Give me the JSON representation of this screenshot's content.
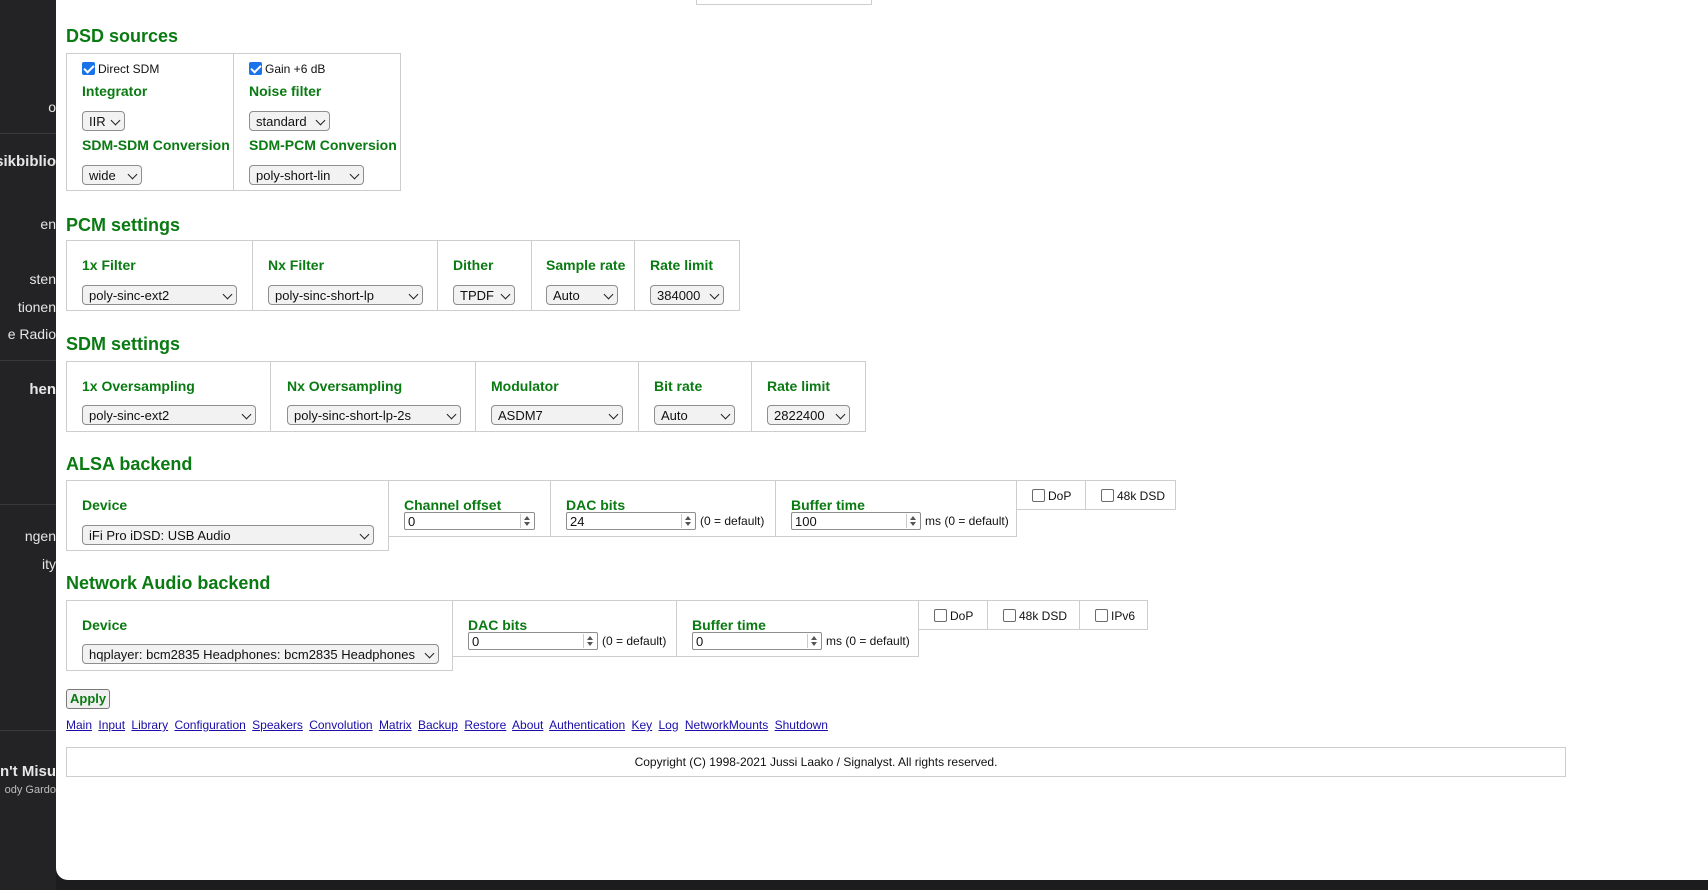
{
  "sidebar": {
    "items": [
      "o",
      "sikbiblio",
      "en",
      "sten",
      "tionen",
      "e Radio",
      "hen",
      "ngen",
      "ity"
    ],
    "now_playing": {
      "title": "n't Misu",
      "artist": "ody Gardo"
    }
  },
  "dsd": {
    "title": "DSD sources",
    "left": {
      "check_label": "Direct SDM",
      "check_on": true,
      "label1": "Integrator",
      "select1": "IIR",
      "label2": "SDM-SDM Conversion",
      "select2": "wide"
    },
    "right": {
      "check_label": "Gain +6 dB",
      "check_on": true,
      "label1": "Noise filter",
      "select1": "standard",
      "label2": "SDM-PCM Conversion",
      "select2": "poly-short-lin"
    }
  },
  "pcm": {
    "title": "PCM settings",
    "fields": [
      {
        "label": "1x Filter",
        "value": "poly-sinc-ext2"
      },
      {
        "label": "Nx Filter",
        "value": "poly-sinc-short-lp"
      },
      {
        "label": "Dither",
        "value": "TPDF"
      },
      {
        "label": "Sample rate",
        "value": "Auto"
      },
      {
        "label": "Rate limit",
        "value": "384000"
      }
    ]
  },
  "sdm": {
    "title": "SDM settings",
    "fields": [
      {
        "label": "1x Oversampling",
        "value": "poly-sinc-ext2"
      },
      {
        "label": "Nx Oversampling",
        "value": "poly-sinc-short-lp-2s"
      },
      {
        "label": "Modulator",
        "value": "ASDM7"
      },
      {
        "label": "Bit rate",
        "value": "Auto"
      },
      {
        "label": "Rate limit",
        "value": "2822400"
      }
    ]
  },
  "alsa": {
    "title": "ALSA backend",
    "device_label": "Device",
    "device_value": "iFi Pro iDSD: USB Audio",
    "channel_offset_label": "Channel offset",
    "channel_offset_value": "0",
    "dac_bits_label": "DAC bits",
    "dac_bits_value": "24",
    "dac_bits_hint": "(0 = default)",
    "buffer_label": "Buffer time",
    "buffer_value": "100",
    "buffer_hint": "ms (0 = default)",
    "dop_label": "DoP",
    "dsd48_label": "48k DSD"
  },
  "network": {
    "title": "Network Audio backend",
    "device_label": "Device",
    "device_value": "hqplayer: bcm2835 Headphones: bcm2835 Headphones",
    "dac_bits_label": "DAC bits",
    "dac_bits_value": "0",
    "dac_bits_hint": "(0 = default)",
    "buffer_label": "Buffer time",
    "buffer_value": "0",
    "buffer_hint": "ms (0 = default)",
    "dop_label": "DoP",
    "dsd48_label": "48k DSD",
    "ipv6_label": "IPv6"
  },
  "apply_label": "Apply",
  "links": [
    "Main",
    "Input",
    "Library",
    "Configuration",
    "Speakers",
    "Convolution",
    "Matrix",
    "Backup",
    "Restore",
    "About",
    "Authentication",
    "Key",
    "Log",
    "NetworkMounts",
    "Shutdown"
  ],
  "footer": "Copyright (C) 1998-2021 Jussi Laako / Signalyst. All rights reserved."
}
